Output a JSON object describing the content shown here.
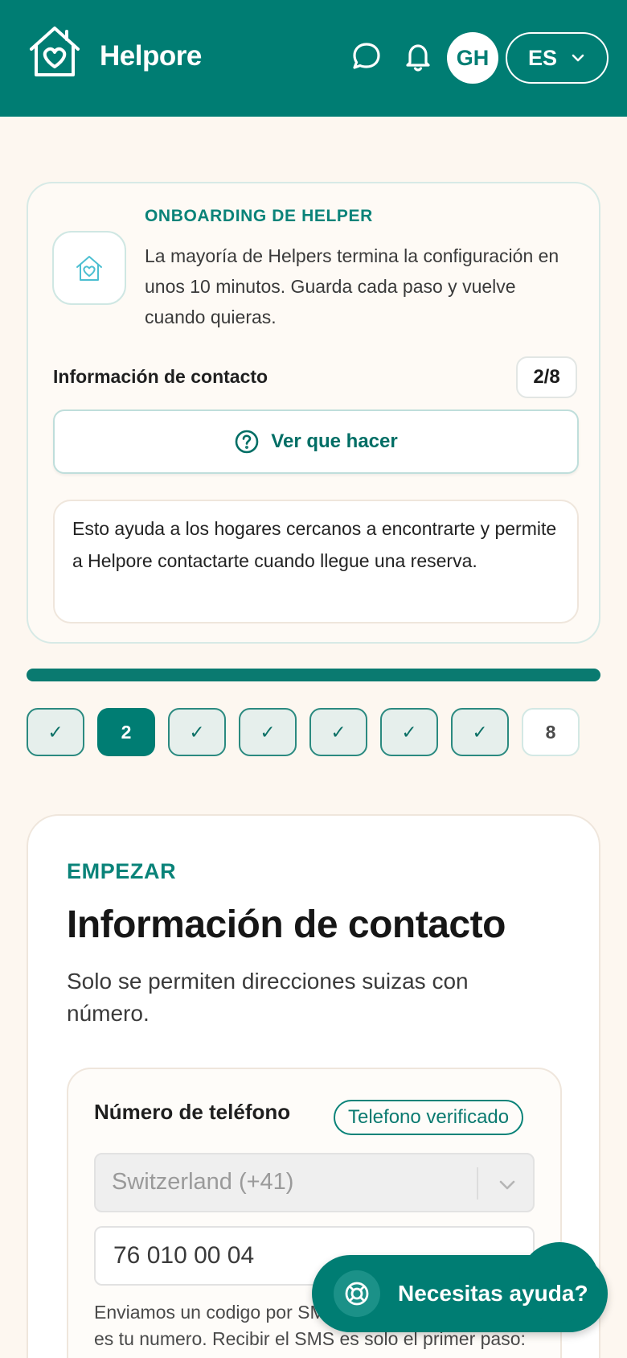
{
  "header": {
    "brand": "Helpore",
    "icons": {
      "logo": "house-heart-icon",
      "chat": "chat-bubble-icon",
      "notifications": "bell-icon"
    },
    "avatar_initials": "GH",
    "language": "ES"
  },
  "onboarding_card": {
    "kicker": "ONBOARDING DE HELPER",
    "description": "La mayoría de Helpers termina la configuración en unos 10 minutos. Guarda cada paso y vuelve cuando quieras.",
    "section_label": "Información de contacto",
    "step_counter": "2/8",
    "help_button_label": "Ver que hacer",
    "info_text": "Esto ayuda a los hogares cercanos a encontrarte y permite a Helpore contactarte cuando llegue una reserva."
  },
  "progress": {
    "fraction": 1.0
  },
  "steps": [
    {
      "label": "✓",
      "state": "done"
    },
    {
      "label": "2",
      "state": "current"
    },
    {
      "label": "✓",
      "state": "done"
    },
    {
      "label": "✓",
      "state": "done"
    },
    {
      "label": "✓",
      "state": "done"
    },
    {
      "label": "✓",
      "state": "done"
    },
    {
      "label": "✓",
      "state": "done"
    },
    {
      "label": "8",
      "state": "todo"
    }
  ],
  "form": {
    "kicker": "EMPEZAR",
    "title": "Información de contacto",
    "subtitle": "Solo se permiten direcciones suizas con número.",
    "phone": {
      "label": "Número de teléfono",
      "verified_badge": "Telefono verificado",
      "country_value": "Switzerland (+41)",
      "number_value": "76 010 00 04",
      "help_text": "Enviamos un codigo por SMS para confirmar que este es tu numero. Recibir el SMS es solo el primer paso: introduces el codigo para terminar."
    }
  },
  "help_fab": {
    "label": "Necesitas ayuda?",
    "icon": "lifebuoy-icon"
  },
  "colors": {
    "primary": "#007d73",
    "background": "#fdf7f0"
  }
}
